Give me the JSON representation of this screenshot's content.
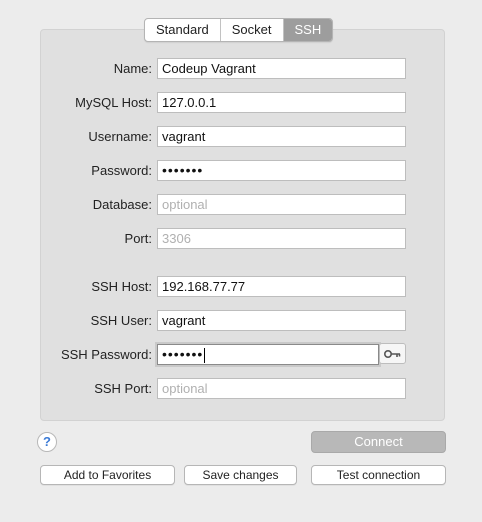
{
  "tabs": {
    "standard": "Standard",
    "socket": "Socket",
    "ssh": "SSH",
    "active": "SSH"
  },
  "form": {
    "name": {
      "label": "Name:",
      "value": "Codeup Vagrant"
    },
    "mysql_host": {
      "label": "MySQL Host:",
      "value": "127.0.0.1"
    },
    "username": {
      "label": "Username:",
      "value": "vagrant"
    },
    "password": {
      "label": "Password:",
      "value": "•••••••"
    },
    "database": {
      "label": "Database:",
      "placeholder": "optional"
    },
    "port": {
      "label": "Port:",
      "placeholder": "3306"
    },
    "ssh_host": {
      "label": "SSH Host:",
      "value": "192.168.77.77"
    },
    "ssh_user": {
      "label": "SSH User:",
      "value": "vagrant"
    },
    "ssh_password": {
      "label": "SSH Password:",
      "value": "•••••••"
    },
    "ssh_port": {
      "label": "SSH Port:",
      "placeholder": "optional"
    }
  },
  "buttons": {
    "help": "?",
    "connect": "Connect",
    "add_favorites": "Add to Favorites",
    "save_changes": "Save changes",
    "test_connection": "Test connection"
  },
  "icons": {
    "key": "key-icon",
    "help": "question-mark-icon"
  }
}
